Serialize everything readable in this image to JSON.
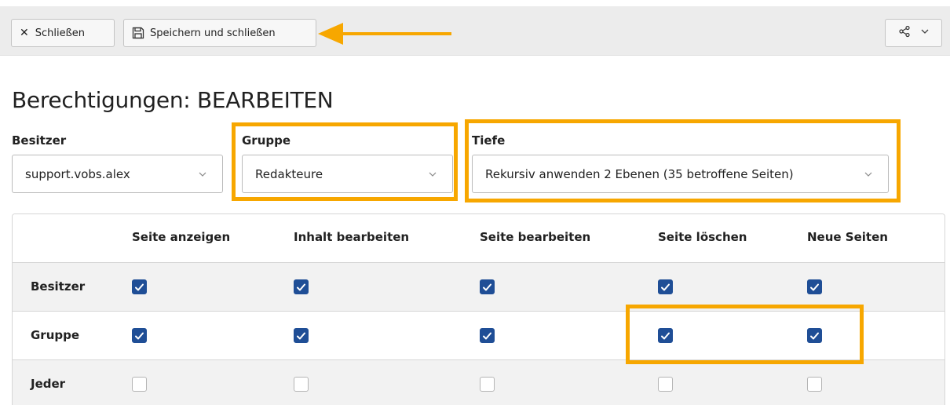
{
  "toolbar": {
    "close_label": "Schließen",
    "save_label": "Speichern und schließen"
  },
  "page": {
    "title": "Berechtigungen: BEARBEITEN"
  },
  "fields": {
    "owner": {
      "label": "Besitzer",
      "value": "support.vobs.alex"
    },
    "group": {
      "label": "Gruppe",
      "value": "Redakteure"
    },
    "depth": {
      "label": "Tiefe",
      "value": "Rekursiv anwenden 2 Ebenen (35 betroffene Seiten)"
    }
  },
  "permissions": {
    "columns": [
      "Seite anzeigen",
      "Inhalt bearbeiten",
      "Seite bearbeiten",
      "Seite löschen",
      "Neue Seiten"
    ],
    "rows": [
      {
        "label": "Besitzer",
        "checked": [
          true,
          true,
          true,
          true,
          true
        ]
      },
      {
        "label": "Gruppe",
        "checked": [
          true,
          true,
          true,
          true,
          true
        ]
      },
      {
        "label": "Jeder",
        "checked": [
          false,
          false,
          false,
          false,
          false
        ]
      }
    ]
  },
  "colors": {
    "highlight": "#f7a700",
    "checkbox_checked": "#1f4e96"
  },
  "icons": {
    "close": "close-icon",
    "save": "save-icon",
    "share": "share-icon",
    "dropdown": "chevron-down-icon",
    "arrow": "annotation-arrow"
  }
}
